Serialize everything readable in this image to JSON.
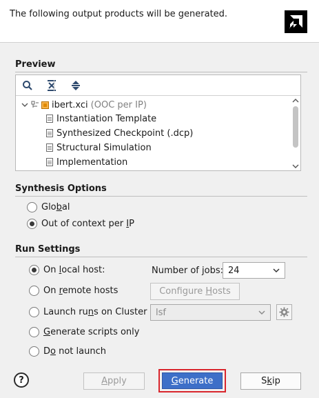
{
  "header": {
    "message": "The following output products will be generated."
  },
  "preview": {
    "title": "Preview",
    "toolbar": {
      "search": "search-icon",
      "collapse_all": "collapse-all-icon",
      "expand_all": "expand-all-icon"
    },
    "tree": {
      "root": {
        "name": "ibert.xci",
        "mode": "(OOC per IP)"
      },
      "children": [
        "Instantiation Template",
        "Synthesized Checkpoint (.dcp)",
        "Structural Simulation",
        "Implementation"
      ]
    }
  },
  "synthesis_options": {
    "title": "Synthesis Options",
    "options": [
      {
        "pre": "Glo",
        "u": "b",
        "post": "al",
        "selected": false
      },
      {
        "pre": "Out of context per ",
        "u": "I",
        "post": "P",
        "selected": true
      }
    ]
  },
  "run_settings": {
    "title": "Run Settings",
    "local_host": {
      "pre": "On ",
      "u": "l",
      "post": "ocal host:",
      "selected": true
    },
    "remote_hosts": {
      "pre": "On ",
      "u": "r",
      "post": "emote hosts",
      "selected": false
    },
    "cluster": {
      "pre": "Launch ru",
      "u": "n",
      "post": "s on Cluster",
      "selected": false
    },
    "scripts_only": {
      "pre": "",
      "u": "G",
      "post": "enerate scripts only",
      "selected": false
    },
    "do_not_launch": {
      "pre": "D",
      "u": "o",
      "post": " not launch",
      "selected": false
    },
    "jobs_label": {
      "pre": "Number of ",
      "u": "j",
      "post": "obs:"
    },
    "jobs_value": "24",
    "configure_hosts": {
      "pre": "Configure ",
      "u": "H",
      "post": "osts"
    },
    "cluster_value": "lsf"
  },
  "footer": {
    "help": "?",
    "apply": {
      "pre": "",
      "u": "A",
      "post": "pply"
    },
    "generate": {
      "pre": "",
      "u": "G",
      "post": "enerate"
    },
    "skip": {
      "pre": "S",
      "u": "k",
      "post": "ip"
    }
  },
  "colors": {
    "primary_button": "#3d6fc8",
    "highlight_border": "#d9252c",
    "ip_icon": "#e08a00"
  }
}
